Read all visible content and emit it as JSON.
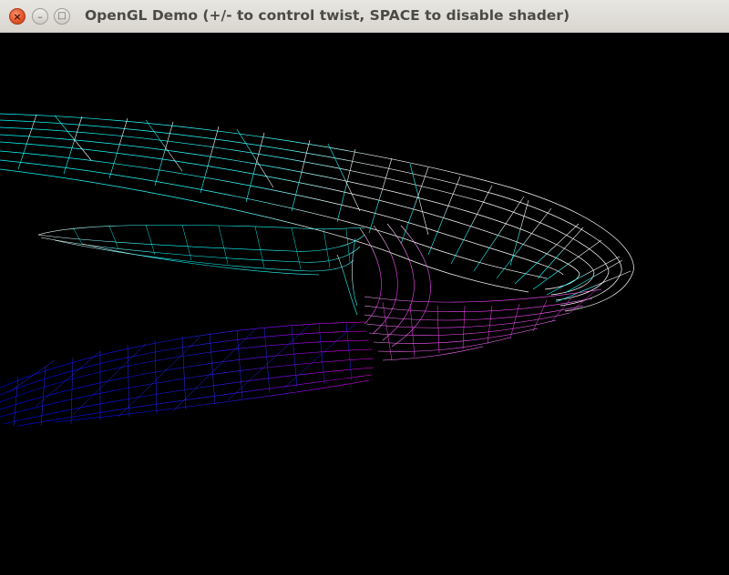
{
  "window": {
    "title": "OpenGL Demo (+/- to control twist, SPACE to disable shader)",
    "close_glyph": "×",
    "minimize_glyph": "–",
    "maximize_glyph": "□"
  },
  "colors": {
    "background": "#000000",
    "mesh_cyan": "#00ffff",
    "mesh_white": "#ffffff",
    "mesh_magenta": "#ff00ff",
    "mesh_blue": "#0000ff",
    "close_button": "#e4572a",
    "titlebar": "#dfdcd6"
  },
  "icons": {
    "close": "close-icon",
    "minimize": "minimize-icon",
    "maximize": "maximize-icon"
  },
  "scene": {
    "object": "twisted wireframe mesh",
    "shader_enabled": true
  }
}
